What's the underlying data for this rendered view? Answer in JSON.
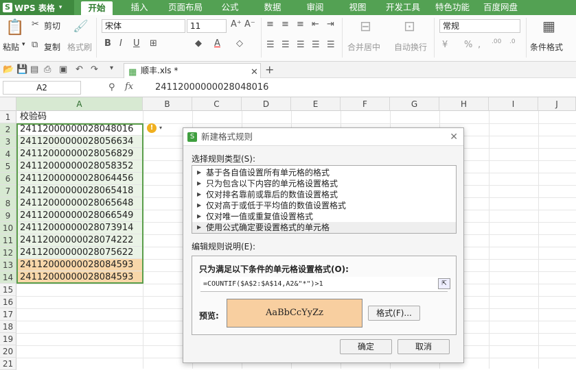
{
  "app": {
    "logo": "WPS 表格"
  },
  "tabs": [
    "开始",
    "插入",
    "页面布局",
    "公式",
    "数据",
    "审阅",
    "视图",
    "开发工具",
    "特色功能",
    "百度网盘"
  ],
  "ribbon": {
    "paste": "粘贴",
    "cut": "剪切",
    "copy": "复制",
    "format_painter": "格式刷",
    "font_name": "宋体",
    "font_size": "11",
    "merge_center": "合并居中",
    "wrap_text": "自动换行",
    "number_format": "常规",
    "conditional_format": "条件格式"
  },
  "file_tab": {
    "name": "顺丰.xls *"
  },
  "formula_bar": {
    "name_box": "A2",
    "fx": "fx",
    "content": "24112000000028048016"
  },
  "columns": [
    "A",
    "B",
    "C",
    "D",
    "E",
    "F",
    "G",
    "H",
    "I",
    "J"
  ],
  "rows": [
    "1",
    "2",
    "3",
    "4",
    "5",
    "6",
    "7",
    "8",
    "9",
    "10",
    "11",
    "12",
    "13",
    "14",
    "15",
    "16",
    "17",
    "18",
    "19",
    "20",
    "21"
  ],
  "cells_a": [
    "校验码",
    "24112000000028048016",
    "24112000000028056634",
    "24112000000028056829",
    "24112000000028058352",
    "24112000000028064456",
    "24112000000028065418",
    "24112000000028065648",
    "24112000000028066549",
    "24112000000028073914",
    "24112000000028074222",
    "24112000000028075622",
    "24112000000028084593",
    "24112000000028084593"
  ],
  "highlight_color": "#f8d7a9",
  "dialog": {
    "title": "新建格式规则",
    "select_type_label": "选择规则类型(S):",
    "rule_types": [
      "基于各自值设置所有单元格的格式",
      "只为包含以下内容的单元格设置格式",
      "仅对排名靠前或靠后的数值设置格式",
      "仅对高于或低于平均值的数值设置格式",
      "仅对唯一值或重复值设置格式",
      "使用公式确定要设置格式的单元格"
    ],
    "edit_label": "编辑规则说明(E):",
    "condition_label": "只为满足以下条件的单元格设置格式(O):",
    "formula": "=COUNTIF($A$2:$A$14,A2&\"*\")>1",
    "preview_label": "预览:",
    "preview_text": "AaBbCcYyZz",
    "format_button": "格式(F)...",
    "ok": "确定",
    "cancel": "取消"
  }
}
